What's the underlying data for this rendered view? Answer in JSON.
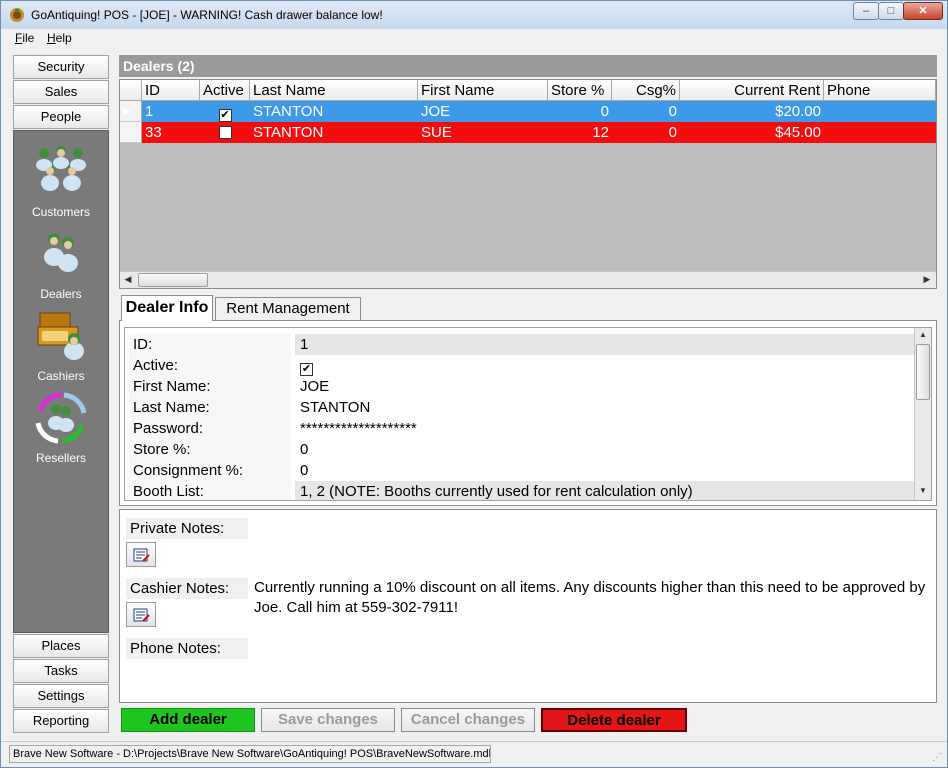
{
  "window": {
    "title": "GoAntiquing! POS - [JOE] - WARNING! Cash drawer balance low!",
    "controls": {
      "minimize": "–",
      "maximize": "□",
      "close": "✕"
    }
  },
  "menu": {
    "file": "F",
    "file_rest": "ile",
    "help": "H",
    "help_rest": "elp"
  },
  "nav": {
    "security": "Security",
    "sales": "Sales",
    "people": "People",
    "places": "Places",
    "tasks": "Tasks",
    "settings": "Settings",
    "reporting": "Reporting",
    "sub": {
      "customers": "Customers",
      "dealers": "Dealers",
      "cashiers": "Cashiers",
      "resellers": "Resellers"
    }
  },
  "grid": {
    "title": "Dealers (2)",
    "columns": {
      "id": "ID",
      "active": "Active",
      "last": "Last Name",
      "first": "First Name",
      "store": "Store %",
      "csg": "Csg%",
      "rent": "Current Rent",
      "phone": "Phone"
    },
    "rows": [
      {
        "id": "1",
        "active": "✔",
        "last": "STANTON",
        "first": "JOE",
        "store": "0",
        "csg": "0",
        "rent": "$20.00",
        "phone": ""
      },
      {
        "id": "33",
        "active": "",
        "last": "STANTON",
        "first": "SUE",
        "store": "12",
        "csg": "0",
        "rent": "$45.00",
        "phone": ""
      }
    ]
  },
  "tabs": {
    "info": "Dealer Info",
    "rent": "Rent Management"
  },
  "info": {
    "rows": [
      {
        "name": "ID:",
        "value": "1"
      },
      {
        "name": "Active:",
        "value": "✔"
      },
      {
        "name": "First Name:",
        "value": "JOE"
      },
      {
        "name": "Last Name:",
        "value": "STANTON"
      },
      {
        "name": "Password:",
        "value": "********************"
      },
      {
        "name": "Store %:",
        "value": "0"
      },
      {
        "name": "Consignment %:",
        "value": "0"
      },
      {
        "name": "Booth List:",
        "value": "1, 2 (NOTE: Booths currently used for rent calculation only)"
      }
    ]
  },
  "notes": {
    "private_label": "Private Notes:",
    "cashier_label": "Cashier Notes:",
    "phone_label": "Phone Notes:",
    "cashier_text": "Currently running a 10% discount on all items.  Any discounts higher than this need to be approved by Joe.  Call him at 559-302-7911!"
  },
  "actions": {
    "add": "Add dealer",
    "save": "Save changes",
    "cancel": "Cancel changes",
    "delete": "Delete dealer"
  },
  "status": {
    "path": "Brave New Software - D:\\Projects\\Brave New Software\\GoAntiquing! POS\\BraveNewSoftware.mdb"
  },
  "colors": {
    "selected_row": "#3d9ae8",
    "alert_row": "#f20e0e",
    "add_button": "#1fc41f",
    "delete_button": "#e31717",
    "nav_panel": "#7a7a7a"
  }
}
